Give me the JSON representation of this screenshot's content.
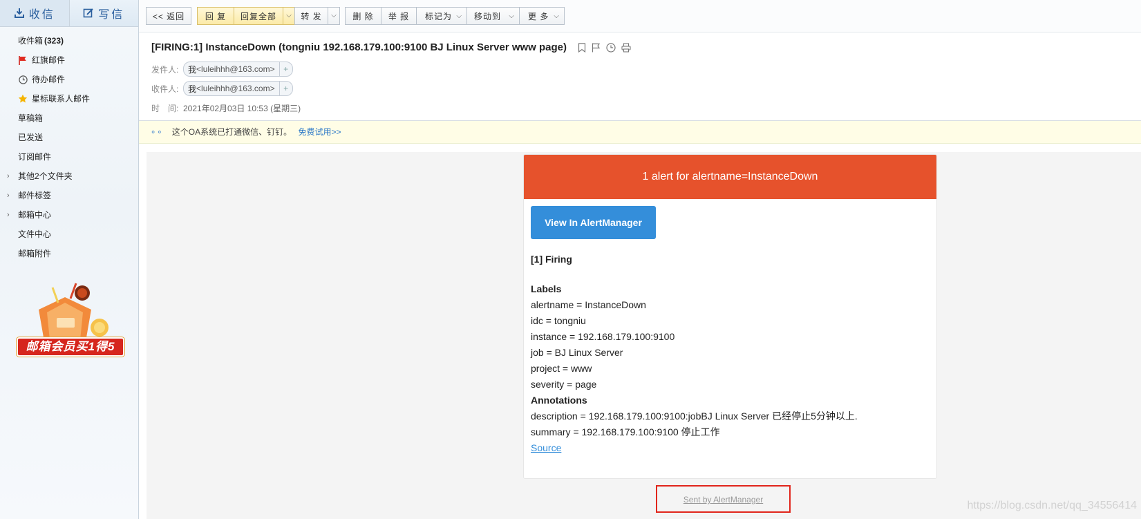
{
  "sidebar": {
    "receive_label": "收信",
    "compose_label": "写信",
    "inbox_label": "收件箱",
    "inbox_count": "(323)",
    "items": [
      {
        "label": "红旗邮件"
      },
      {
        "label": "待办邮件"
      },
      {
        "label": "星标联系人邮件"
      },
      {
        "label": "草稿箱"
      },
      {
        "label": "已发送"
      },
      {
        "label": "订阅邮件"
      },
      {
        "label": "其他2个文件夹"
      },
      {
        "label": "邮件标签"
      },
      {
        "label": "邮箱中心"
      },
      {
        "label": "文件中心"
      },
      {
        "label": "邮箱附件"
      }
    ],
    "promo_text": "邮箱会员买1得5"
  },
  "toolbar": {
    "back": "<< 返回",
    "reply": "回 复",
    "reply_all": "回复全部",
    "forward": "转 发",
    "delete": "删 除",
    "report": "举 报",
    "mark_as": "标记为",
    "move_to": "移动到",
    "more": "更 多"
  },
  "mail": {
    "subject": "[FIRING:1] InstanceDown (tongniu 192.168.179.100:9100 BJ Linux Server www page)",
    "from_label": "发件人:",
    "from_name": "我",
    "from_addr": "<luleihhh@163.com>",
    "to_label": "收件人:",
    "to_name": "我",
    "to_addr": "<luleihhh@163.com>",
    "time_label": "时　间:",
    "time_value": "2021年02月03日 10:53 (星期三)"
  },
  "notice": {
    "text": "这个OA系统已打通微信、钉钉。",
    "link": "免费试用>>"
  },
  "alert": {
    "header": "1 alert for alertname=InstanceDown",
    "button": "View In AlertManager",
    "firing": "[1] Firing",
    "labels_title": "Labels",
    "labels": [
      "alertname = InstanceDown",
      "idc = tongniu",
      "instance = 192.168.179.100:9100",
      "job = BJ Linux Server",
      "project = www",
      "severity = page"
    ],
    "annotations_title": "Annotations",
    "annotations": [
      "description = 192.168.179.100:9100:jobBJ Linux Server 已经停止5分钟以上.",
      "summary = 192.168.179.100:9100 停止工作"
    ],
    "source": "Source",
    "footer": "Sent by AlertManager"
  },
  "watermark": "https://blog.csdn.net/qq_34556414",
  "colors": {
    "alert_header": "#e6522c",
    "button_blue": "#348eda",
    "highlight_box": "#e1251b"
  }
}
